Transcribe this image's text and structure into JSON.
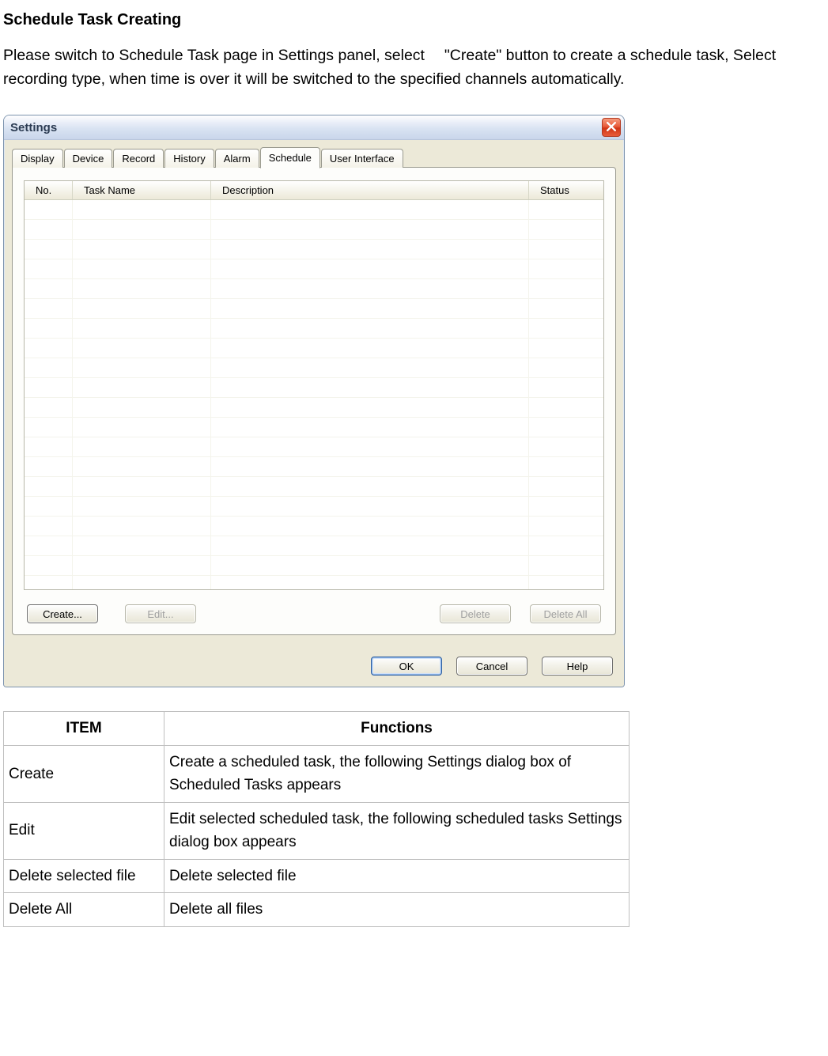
{
  "heading": "Schedule Task Creating",
  "paragraph": "Please switch to Schedule Task page in Settings panel, select  \"Create\" button to create a schedule task, Select recording type, when time is over it will be switched to the specified channels automatically.",
  "dialog": {
    "title": "Settings",
    "tabs": [
      "Display",
      "Device",
      "Record",
      "History",
      "Alarm",
      "Schedule",
      "User Interface"
    ],
    "active_tab_index": 5,
    "columns": {
      "no": "No.",
      "task": "Task Name",
      "desc": "Description",
      "status": "Status"
    },
    "row_count": 20,
    "panel_buttons": {
      "create": "Create...",
      "edit": "Edit...",
      "delete": "Delete",
      "delete_all": "Delete All"
    },
    "dialog_buttons": {
      "ok": "OK",
      "cancel": "Cancel",
      "help": "Help"
    }
  },
  "doc_table": {
    "head_item": "ITEM",
    "head_func": "Functions",
    "rows": [
      {
        "item": "Create",
        "func": "Create a scheduled task, the following Settings dialog box of Scheduled Tasks appears"
      },
      {
        "item": "Edit",
        "func": "Edit selected scheduled task, the following scheduled tasks Settings dialog box appears"
      },
      {
        "item": "Delete selected file",
        "func": "Delete selected file"
      },
      {
        "item": "Delete All",
        "func": "Delete all files"
      }
    ]
  }
}
